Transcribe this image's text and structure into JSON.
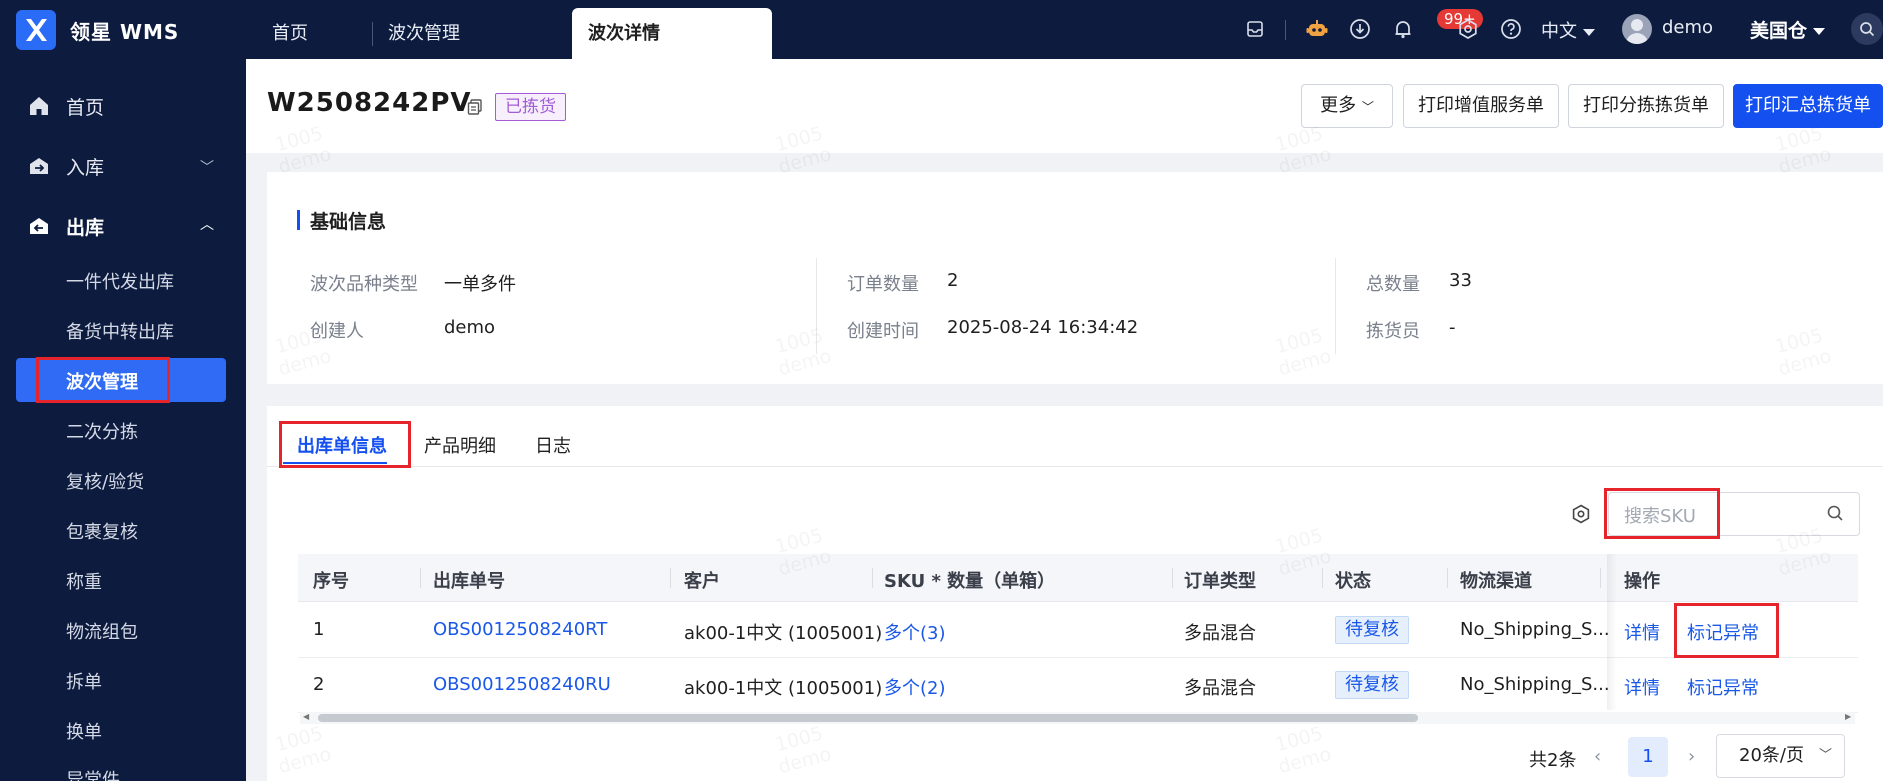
{
  "app": {
    "brand": "领星 WMS"
  },
  "top_tabs": [
    {
      "label": "首页"
    },
    {
      "label": "波次管理"
    },
    {
      "label": "波次详情",
      "active": true
    }
  ],
  "topbar": {
    "notification_count": "99+",
    "language": "中文",
    "username": "demo",
    "warehouse": "美国仓",
    "icons": [
      "inbox-icon",
      "robot-icon",
      "download-icon",
      "bell-icon",
      "settings-icon",
      "help-icon",
      "search-icon"
    ]
  },
  "sidebar": {
    "items": [
      {
        "label": "首页",
        "icon": "home-icon"
      },
      {
        "label": "入库",
        "icon": "inbound-icon",
        "expanded": false
      },
      {
        "label": "出库",
        "icon": "outbound-icon",
        "expanded": true
      }
    ],
    "sub_items": [
      {
        "label": "一件代发出库"
      },
      {
        "label": "备货中转出库"
      },
      {
        "label": "波次管理",
        "active": true
      },
      {
        "label": "二次分拣"
      },
      {
        "label": "复核/验货"
      },
      {
        "label": "包裹复核"
      },
      {
        "label": "称重"
      },
      {
        "label": "物流组包"
      },
      {
        "label": "拆单"
      },
      {
        "label": "换单"
      },
      {
        "label": "异常件"
      }
    ]
  },
  "header": {
    "wave_no": "W2508242PV",
    "status_tag": "已拣货",
    "buttons": {
      "more": "更多",
      "print_vas": "打印增值服务单",
      "print_sort": "打印分拣拣货单",
      "print_summary": "打印汇总拣货单"
    }
  },
  "basic_info": {
    "title": "基础信息",
    "fields": {
      "wave_type_label": "波次品种类型",
      "wave_type_value": "一单多件",
      "creator_label": "创建人",
      "creator_value": "demo",
      "order_count_label": "订单数量",
      "order_count_value": "2",
      "created_time_label": "创建时间",
      "created_time_value": "2025-08-24 16:34:42",
      "total_qty_label": "总数量",
      "total_qty_value": "33",
      "picker_label": "拣货员",
      "picker_value": "-"
    }
  },
  "detail_tabs": [
    {
      "label": "出库单信息",
      "active": true
    },
    {
      "label": "产品明细"
    },
    {
      "label": "日志"
    }
  ],
  "search": {
    "placeholder": "搜索SKU"
  },
  "table": {
    "columns": [
      "序号",
      "出库单号",
      "客户",
      "SKU * 数量（单箱）",
      "订单类型",
      "状态",
      "物流渠道",
      "操作"
    ],
    "rows": [
      {
        "no": "1",
        "order_no": "OBS0012508240RT",
        "customer": "ak00-1中文 (1005001)",
        "sku": "多个(3)",
        "order_type": "多品混合",
        "status": "待复核",
        "channel": "No_Shipping_S...",
        "action_detail": "详情",
        "action_mark": "标记异常"
      },
      {
        "no": "2",
        "order_no": "OBS0012508240RU",
        "customer": "ak00-1中文 (1005001)",
        "sku": "多个(2)",
        "order_type": "多品混合",
        "status": "待复核",
        "channel": "No_Shipping_S...",
        "action_detail": "详情",
        "action_mark": "标记异常"
      }
    ]
  },
  "pagination": {
    "total": "共2条",
    "current_page": "1",
    "page_size": "20条/页"
  },
  "watermark": {
    "line1": "1005",
    "line2": "demo"
  },
  "colors": {
    "nav_bg": "#0d1b3e",
    "primary": "#1450f0",
    "highlight_box": "#e5242b",
    "tag_purple": "#a15cd6"
  }
}
